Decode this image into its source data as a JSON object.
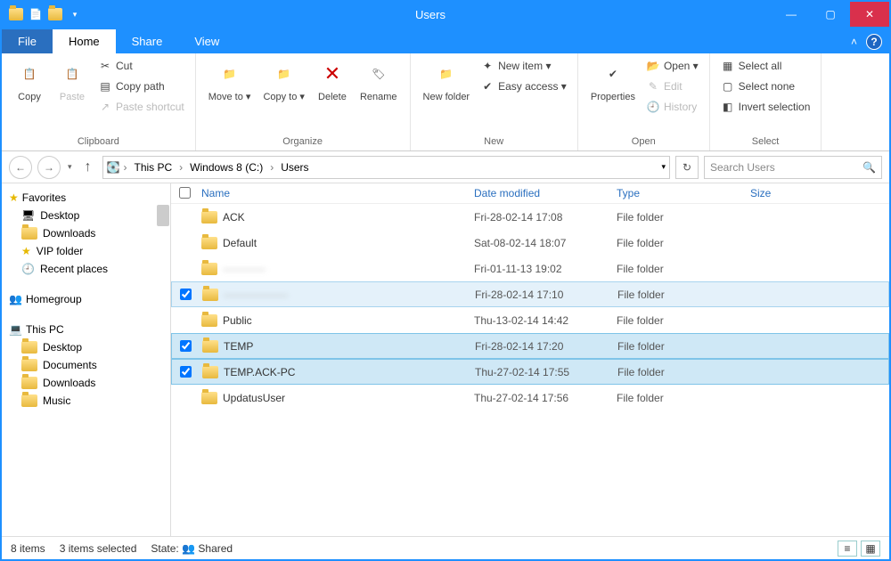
{
  "title": "Users",
  "tabs": {
    "file": "File",
    "home": "Home",
    "share": "Share",
    "view": "View"
  },
  "ribbon": {
    "clipboard": {
      "label": "Clipboard",
      "copy": "Copy",
      "paste": "Paste",
      "cut": "Cut",
      "copypath": "Copy path",
      "pasteshortcut": "Paste shortcut"
    },
    "organize": {
      "label": "Organize",
      "moveto": "Move\nto ▾",
      "copyto": "Copy\nto ▾",
      "delete": "Delete",
      "rename": "Rename"
    },
    "new": {
      "label": "New",
      "newfolder": "New\nfolder",
      "newitem": "New item ▾",
      "easyaccess": "Easy access ▾"
    },
    "open": {
      "label": "Open",
      "properties": "Properties",
      "open": "Open ▾",
      "edit": "Edit",
      "history": "History"
    },
    "select": {
      "label": "Select",
      "selectall": "Select all",
      "selectnone": "Select none",
      "invert": "Invert selection"
    }
  },
  "breadcrumb": [
    "This PC",
    "Windows 8 (C:)",
    "Users"
  ],
  "search_placeholder": "Search Users",
  "sidebar": {
    "favorites": "Favorites",
    "fav_items": [
      "Desktop",
      "Downloads",
      "VIP folder",
      "Recent places"
    ],
    "homegroup": "Homegroup",
    "thispc": "This PC",
    "pc_items": [
      "Desktop",
      "Documents",
      "Downloads",
      "Music"
    ]
  },
  "columns": {
    "name": "Name",
    "date": "Date modified",
    "type": "Type",
    "size": "Size"
  },
  "rows": [
    {
      "name": "ACK",
      "date": "Fri-28-02-14 17:08",
      "type": "File folder",
      "sel": false,
      "blur": false
    },
    {
      "name": "Default",
      "date": "Sat-08-02-14 18:07",
      "type": "File folder",
      "sel": false,
      "blur": false
    },
    {
      "name": "————",
      "date": "Fri-01-11-13 19:02",
      "type": "File folder",
      "sel": false,
      "blur": true
    },
    {
      "name": "——————",
      "date": "Fri-28-02-14 17:10",
      "type": "File folder",
      "sel": "top",
      "blur": true
    },
    {
      "name": "Public",
      "date": "Thu-13-02-14 14:42",
      "type": "File folder",
      "sel": false,
      "blur": false
    },
    {
      "name": "TEMP",
      "date": "Fri-28-02-14 17:20",
      "type": "File folder",
      "sel": true,
      "blur": false
    },
    {
      "name": "TEMP.ACK-PC",
      "date": "Thu-27-02-14 17:55",
      "type": "File folder",
      "sel": true,
      "blur": false
    },
    {
      "name": "UpdatusUser",
      "date": "Thu-27-02-14 17:56",
      "type": "File folder",
      "sel": false,
      "blur": false
    }
  ],
  "status": {
    "items": "8 items",
    "selected": "3 items selected",
    "state_label": "State:",
    "state_value": "Shared"
  }
}
